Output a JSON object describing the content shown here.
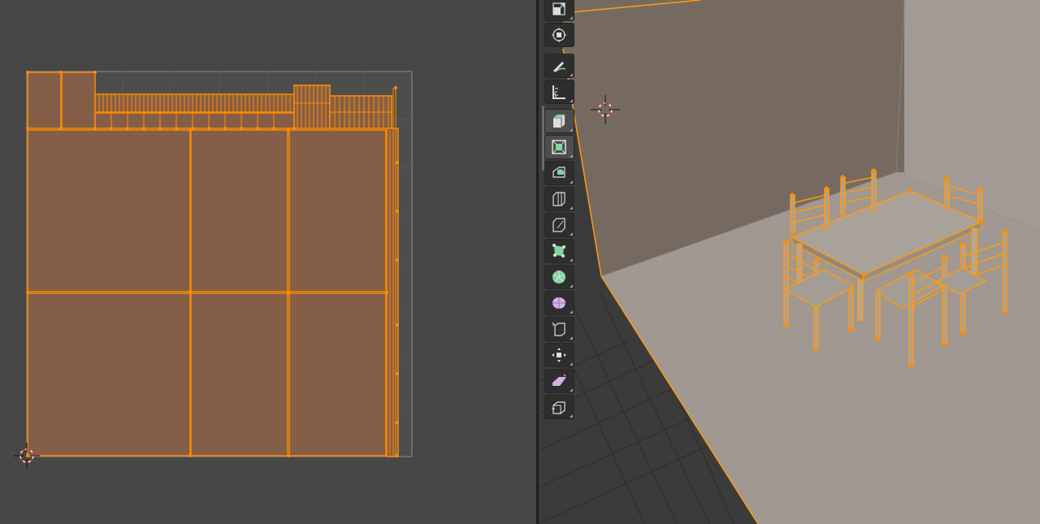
{
  "app": {
    "left_editor": "uv-editor",
    "right_editor": "3d-viewport"
  },
  "colors": {
    "uv_background": "#474747",
    "uv_face_fill": "#8a5f46",
    "uv_edge": "#ff8c00",
    "viewport_floor": "#a09891",
    "viewport_wall_back": "#766a60",
    "viewport_wall_right": "#a19a95",
    "grid_floor": "#363636",
    "selection": "#ff9a10",
    "tool_active": "#4e4e4e",
    "tool_inactive": "#2e2e2e"
  },
  "toolbar": {
    "tools": [
      {
        "name": "scale-tool",
        "icon": "scale-icon",
        "active": false
      },
      {
        "name": "transform-tool",
        "icon": "transform-icon",
        "active": false
      },
      {
        "name": "annotate-tool",
        "icon": "annotate-icon",
        "active": false
      },
      {
        "name": "measure-tool",
        "icon": "measure-icon",
        "active": false
      },
      {
        "name": "add-cube-tool",
        "icon": "add-cube-icon",
        "active": true
      },
      {
        "name": "extrude-region-tool",
        "icon": "extrude-region-icon",
        "active": true
      },
      {
        "name": "inset-faces-tool",
        "icon": "inset-faces-icon",
        "active": false
      },
      {
        "name": "bevel-tool",
        "icon": "bevel-icon",
        "active": false
      },
      {
        "name": "loop-cut-tool",
        "icon": "loop-cut-icon",
        "active": false
      },
      {
        "name": "knife-tool",
        "icon": "knife-icon",
        "active": false
      },
      {
        "name": "poly-build-tool",
        "icon": "poly-build-icon",
        "active": false
      },
      {
        "name": "spin-tool",
        "icon": "spin-icon",
        "active": false
      },
      {
        "name": "smooth-tool",
        "icon": "smooth-icon",
        "active": false
      },
      {
        "name": "edge-slide-tool",
        "icon": "edge-slide-icon",
        "active": false
      },
      {
        "name": "shrink-fatten-tool",
        "icon": "shrink-fatten-icon",
        "active": false
      },
      {
        "name": "shear-tool",
        "icon": "shear-icon",
        "active": false
      },
      {
        "name": "rip-region-tool",
        "icon": "rip-region-icon",
        "active": false
      }
    ]
  }
}
